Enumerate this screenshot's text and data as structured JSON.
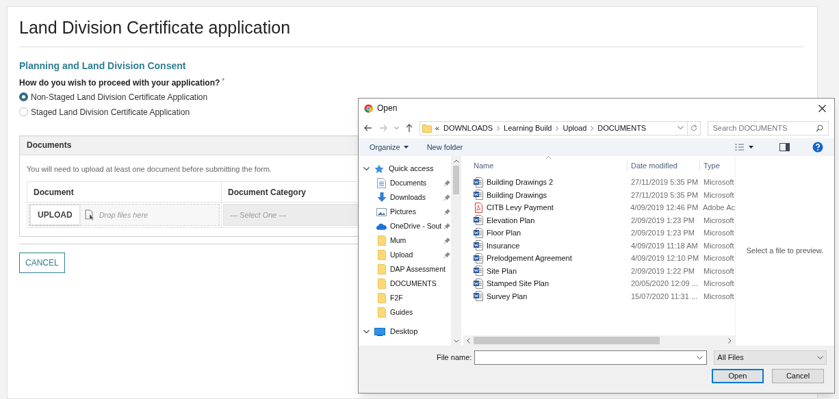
{
  "page": {
    "title": "Land Division Certificate application",
    "section_title": "Planning and Land Division Consent",
    "question": "How do you wish to proceed with your application?",
    "required_mark": "*",
    "options": [
      {
        "label": "Non-Staged Land Division Certificate Application",
        "selected": true
      },
      {
        "label": "Staged Land Division Certificate Application",
        "selected": false
      }
    ],
    "documents": {
      "title": "Documents",
      "note": "You will need to upload at least one document before submitting the form.",
      "columns": [
        "Document",
        "Document Category"
      ],
      "upload_button": "UPLOAD",
      "drop_hint": "Drop files here",
      "category_placeholder": "--- Select One ---"
    },
    "cancel_button": "CANCEL"
  },
  "dialog": {
    "title": "Open",
    "path": [
      "«",
      "DOWNLOADS",
      "Learning Build",
      "Upload",
      "DOCUMENTS"
    ],
    "search_placeholder": "Search DOCUMENTS",
    "organize": "Organize",
    "new_folder": "New folder",
    "nav": [
      {
        "kind": "quickaccess",
        "label": "Quick access",
        "expanded": true
      },
      {
        "kind": "documents",
        "label": "Documents",
        "pinned": true
      },
      {
        "kind": "downloads",
        "label": "Downloads",
        "pinned": true
      },
      {
        "kind": "pictures",
        "label": "Pictures",
        "pinned": true
      },
      {
        "kind": "cloud",
        "label": "OneDrive - Sout",
        "pinned": true
      },
      {
        "kind": "folder",
        "label": "Mum",
        "pinned": true
      },
      {
        "kind": "folder",
        "label": "Upload",
        "pinned": true
      },
      {
        "kind": "folder",
        "label": "DAP Assessment",
        "pinned": false
      },
      {
        "kind": "folder",
        "label": "DOCUMENTS",
        "pinned": false
      },
      {
        "kind": "folder",
        "label": "F2F",
        "pinned": false
      },
      {
        "kind": "folder",
        "label": "Guides",
        "pinned": false
      },
      {
        "kind": "desktop",
        "label": "Desktop",
        "expanded": true
      }
    ],
    "columns": [
      "Name",
      "Date modified",
      "Type"
    ],
    "files": [
      {
        "name": "Building Drawings 2",
        "date": "27/11/2019 5:35 PM",
        "type": "Microsoft",
        "kind": "word"
      },
      {
        "name": "Building Drawings",
        "date": "27/11/2019 5:35 PM",
        "type": "Microsoft",
        "kind": "word"
      },
      {
        "name": "CITB Levy Payment",
        "date": "4/09/2019 12:46 PM",
        "type": "Adobe Ac",
        "kind": "pdf"
      },
      {
        "name": "Elevation Plan",
        "date": "2/09/2019 1:23 PM",
        "type": "Microsoft",
        "kind": "word"
      },
      {
        "name": "Floor Plan",
        "date": "2/09/2019 1:23 PM",
        "type": "Microsoft",
        "kind": "word"
      },
      {
        "name": "Insurance",
        "date": "4/09/2019 11:18 AM",
        "type": "Microsoft",
        "kind": "word"
      },
      {
        "name": "Prelodgement Agreement",
        "date": "4/09/2019 12:10 PM",
        "type": "Microsoft",
        "kind": "word"
      },
      {
        "name": "Site Plan",
        "date": "2/09/2019 1:22 PM",
        "type": "Microsoft",
        "kind": "word"
      },
      {
        "name": "Stamped Site Plan",
        "date": "20/05/2020 12:09 ...",
        "type": "Microsoft",
        "kind": "word"
      },
      {
        "name": "Survey Plan",
        "date": "15/07/2020 11:31 ...",
        "type": "Microsoft",
        "kind": "word"
      }
    ],
    "preview_text": "Select a file to preview.",
    "file_name_label": "File name:",
    "file_type": "All Files",
    "open_button": "Open",
    "cancel_button": "Cancel"
  }
}
